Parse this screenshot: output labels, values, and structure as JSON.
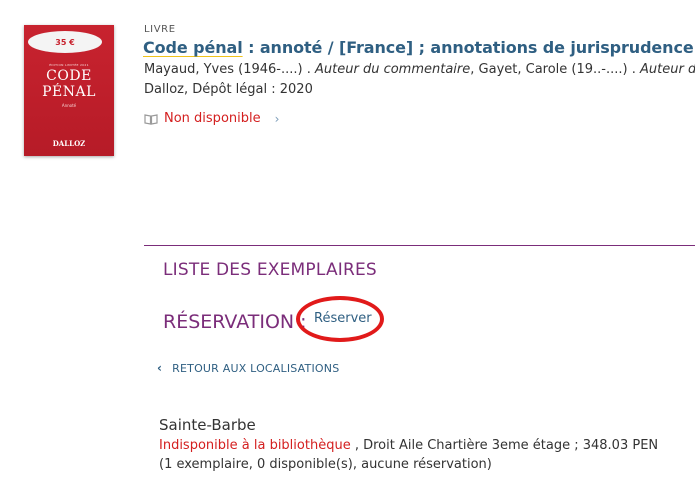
{
  "cover": {
    "sticker": "35 €",
    "edition": "ÉDITION LIMITÉE 2021",
    "title_line1": "CODE",
    "title_line2": "PÉNAL",
    "year": "Annoté",
    "publisher": "DALLOZ"
  },
  "record": {
    "type": "LIVRE",
    "title_main": "Code pénal",
    "title_rest": " : annoté / [France] ; annotations de jurisprudence et bibliographie",
    "author1": "Mayaud, Yves (1946-....) .",
    "author1_role": "Auteur du commentaire",
    "author2": ", Gayet, Carole (19..-....) .",
    "author2_role": "Auteur du commentaire",
    "publication": "Dalloz, Dépôt légal : 2020",
    "availability": "Non disponible"
  },
  "copies": {
    "list_title": "LISTE DES EXEMPLAIRES",
    "reservation_label": "RÉSERVATION :",
    "reserve_button": "Réserver",
    "back_link": "RETOUR AUX LOCALISATIONS"
  },
  "location": {
    "name": "Sainte-Barbe",
    "status": "Indisponible à la bibliothèque",
    "details": " , Droit Aile Chartière 3eme étage ; 348.03 PEN",
    "count": "(1 exemplaire, 0 disponible(s), aucune réservation)"
  },
  "colors": {
    "accent_purple": "#7b2d7a",
    "link_blue": "#2f5f82",
    "status_red": "#d42020",
    "highlight_ring": "#e11a1a"
  }
}
